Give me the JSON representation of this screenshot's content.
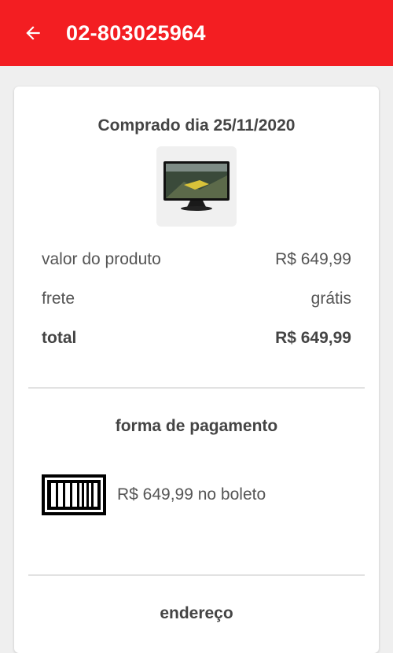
{
  "header": {
    "order_number": "02-803025964",
    "background_color": "#f31e22",
    "back_icon": "arrow-left-icon"
  },
  "order": {
    "purchase_date_label": "Comprado dia 25/11/2020",
    "product_image": "monitor-product-image",
    "summary": [
      {
        "label": "valor do produto",
        "value": "R$ 649,99"
      },
      {
        "label": "frete",
        "value": "grátis"
      },
      {
        "label": "total",
        "value": "R$ 649,99"
      }
    ]
  },
  "payment": {
    "section_title": "forma de pagamento",
    "icon": "barcode-icon",
    "description": "R$ 649,99 no boleto"
  },
  "address": {
    "section_title": "endereço"
  }
}
